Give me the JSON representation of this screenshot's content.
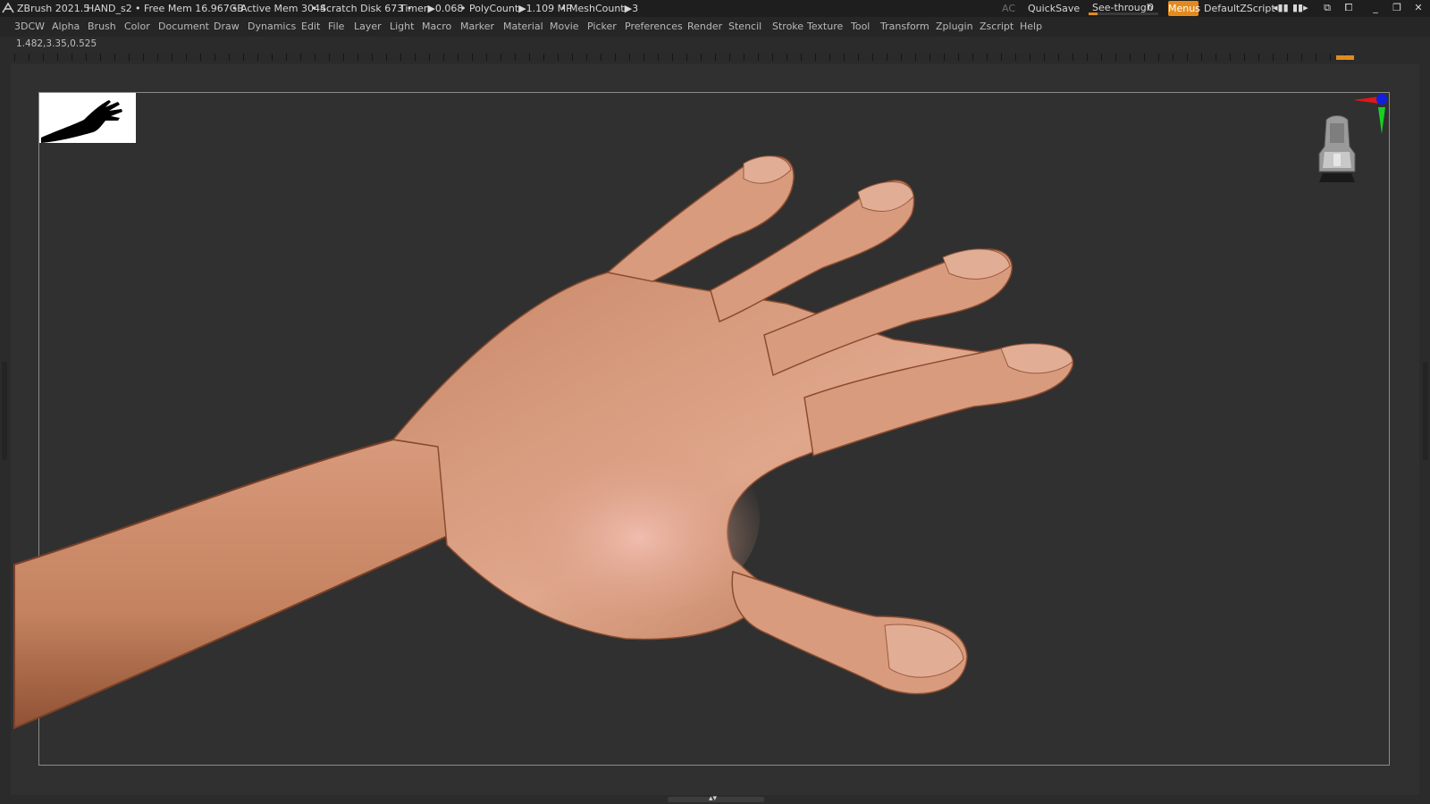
{
  "titlebar": {
    "app_name": "ZBrush 2021.5",
    "document_name": "HAND_s2",
    "free_mem": "• Free Mem 16.967GB",
    "active_mem": "• Active Mem 3044",
    "scratch_disk": "• Scratch Disk 673 •",
    "timer": "Timer▶0.068",
    "poly_count": "• PolyCount▶1.109 MP",
    "mesh_count": "• MeshCount▶3",
    "ac_label": "AC",
    "quicksave_label": "QuickSave",
    "see_through_label": "See-through",
    "see_through_value": "0",
    "menus_label": "Menus",
    "default_zscript": "DefaultZScript",
    "accent_color": "#e38a1e"
  },
  "menubar": {
    "items": [
      "3DCW",
      "Alpha",
      "Brush",
      "Color",
      "Document",
      "Draw",
      "Dynamics",
      "Edit",
      "File",
      "Layer",
      "Light",
      "Macro",
      "Marker",
      "Material",
      "Movie",
      "Picker",
      "Preferences",
      "Render",
      "Stencil",
      "Stroke",
      "Texture",
      "Tool",
      "Transform",
      "Zplugin",
      "Zscript",
      "Help"
    ]
  },
  "canvas": {
    "coordinates": "1.482,3.35,0.525",
    "model_color": "#d49578",
    "background_color": "#303030"
  },
  "icons": {
    "logo": "zbrush-logo-icon",
    "gizmo": "axis-gizmo-icon",
    "navcube": "navigation-cube-icon",
    "thumbnail": "hand-silhouette-thumbnail"
  }
}
